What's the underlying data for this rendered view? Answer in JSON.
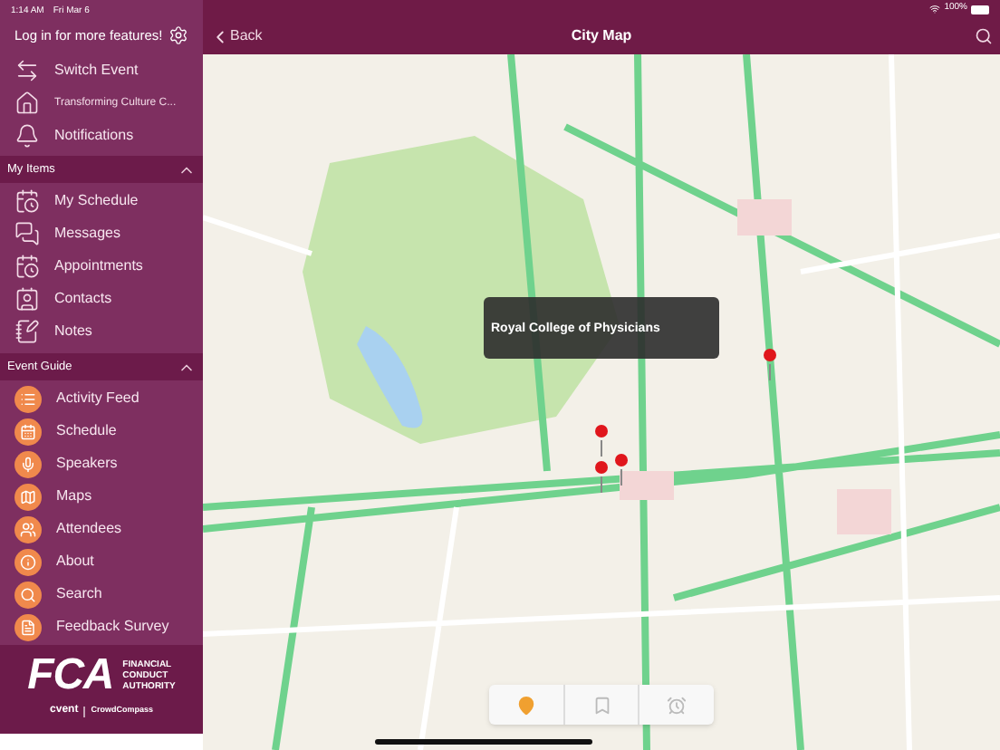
{
  "status_bar": {
    "time": "1:14 AM",
    "date": "Fri Mar 6",
    "battery": "100%"
  },
  "sidebar": {
    "login": "Log in for more features!",
    "top_items": [
      {
        "kind": "switch",
        "label": "Switch Event"
      },
      {
        "kind": "home",
        "label": "Transforming Culture C..."
      },
      {
        "kind": "bell",
        "label": "Notifications"
      }
    ],
    "sections": [
      {
        "title": "My Items",
        "expanded": true,
        "items": [
          {
            "kind": "schedule",
            "label": "My Schedule"
          },
          {
            "kind": "messages",
            "label": "Messages"
          },
          {
            "kind": "appointments",
            "label": "Appointments"
          },
          {
            "kind": "contacts",
            "label": "Contacts"
          },
          {
            "kind": "notes",
            "label": "Notes"
          }
        ]
      },
      {
        "title": "Event Guide",
        "expanded": true,
        "items": [
          {
            "kind": "feed",
            "label": "Activity Feed"
          },
          {
            "kind": "calendar",
            "label": "Schedule"
          },
          {
            "kind": "speakers",
            "label": "Speakers"
          },
          {
            "kind": "maps",
            "label": "Maps"
          },
          {
            "kind": "attendees",
            "label": "Attendees"
          },
          {
            "kind": "about",
            "label": "About"
          },
          {
            "kind": "search",
            "label": "Search"
          },
          {
            "kind": "survey",
            "label": "Feedback Survey"
          }
        ]
      }
    ],
    "footer": {
      "logo": "FCA",
      "org_lines": [
        "FINANCIAL",
        "CONDUCT",
        "AUTHORITY"
      ],
      "vendor": "cvent",
      "partner": "CrowdCompass"
    }
  },
  "nav_bar": {
    "back": "Back",
    "title": "City Map"
  },
  "map": {
    "callout": "Royal College of Physicians",
    "toolbar": [
      {
        "kind": "pin",
        "selected": true
      },
      {
        "kind": "bookmark",
        "selected": false
      },
      {
        "kind": "alarm",
        "selected": false
      }
    ]
  }
}
